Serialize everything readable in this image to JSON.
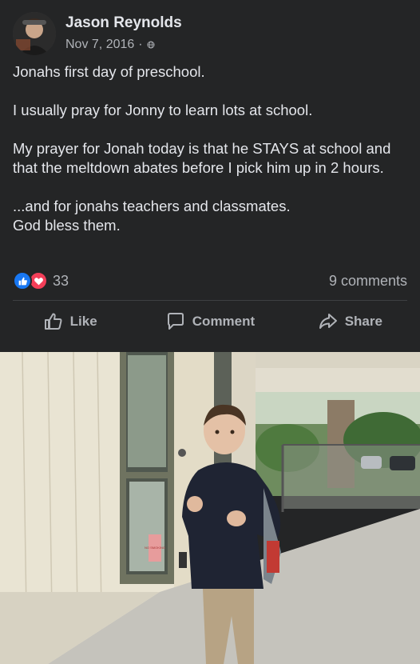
{
  "post": {
    "author": "Jason Reynolds",
    "date": "Nov 7, 2016",
    "separator": "·",
    "audience_icon": "globe-icon",
    "paragraphs": [
      "Jonahs first day of preschool.",
      "I usually pray for Jonny to learn lots at school.",
      "My prayer for Jonah today is that he STAYS at school and that the meltdown abates before I pick him up in 2 hours.",
      "...and for jonahs teachers and classmates.\nGod bless them."
    ],
    "reaction_count": "33",
    "comments_count": "9 comments",
    "reactions": [
      "like",
      "love"
    ]
  },
  "actions": {
    "like": "Like",
    "comment": "Comment",
    "share": "Share"
  },
  "photo": {
    "sign_text": "NO SMOKING"
  },
  "colors": {
    "background": "#242526",
    "text": "#e4e6eb",
    "secondary": "#b0b3b8",
    "like_blue": "#1877f2",
    "love_red": "#f33e58"
  }
}
